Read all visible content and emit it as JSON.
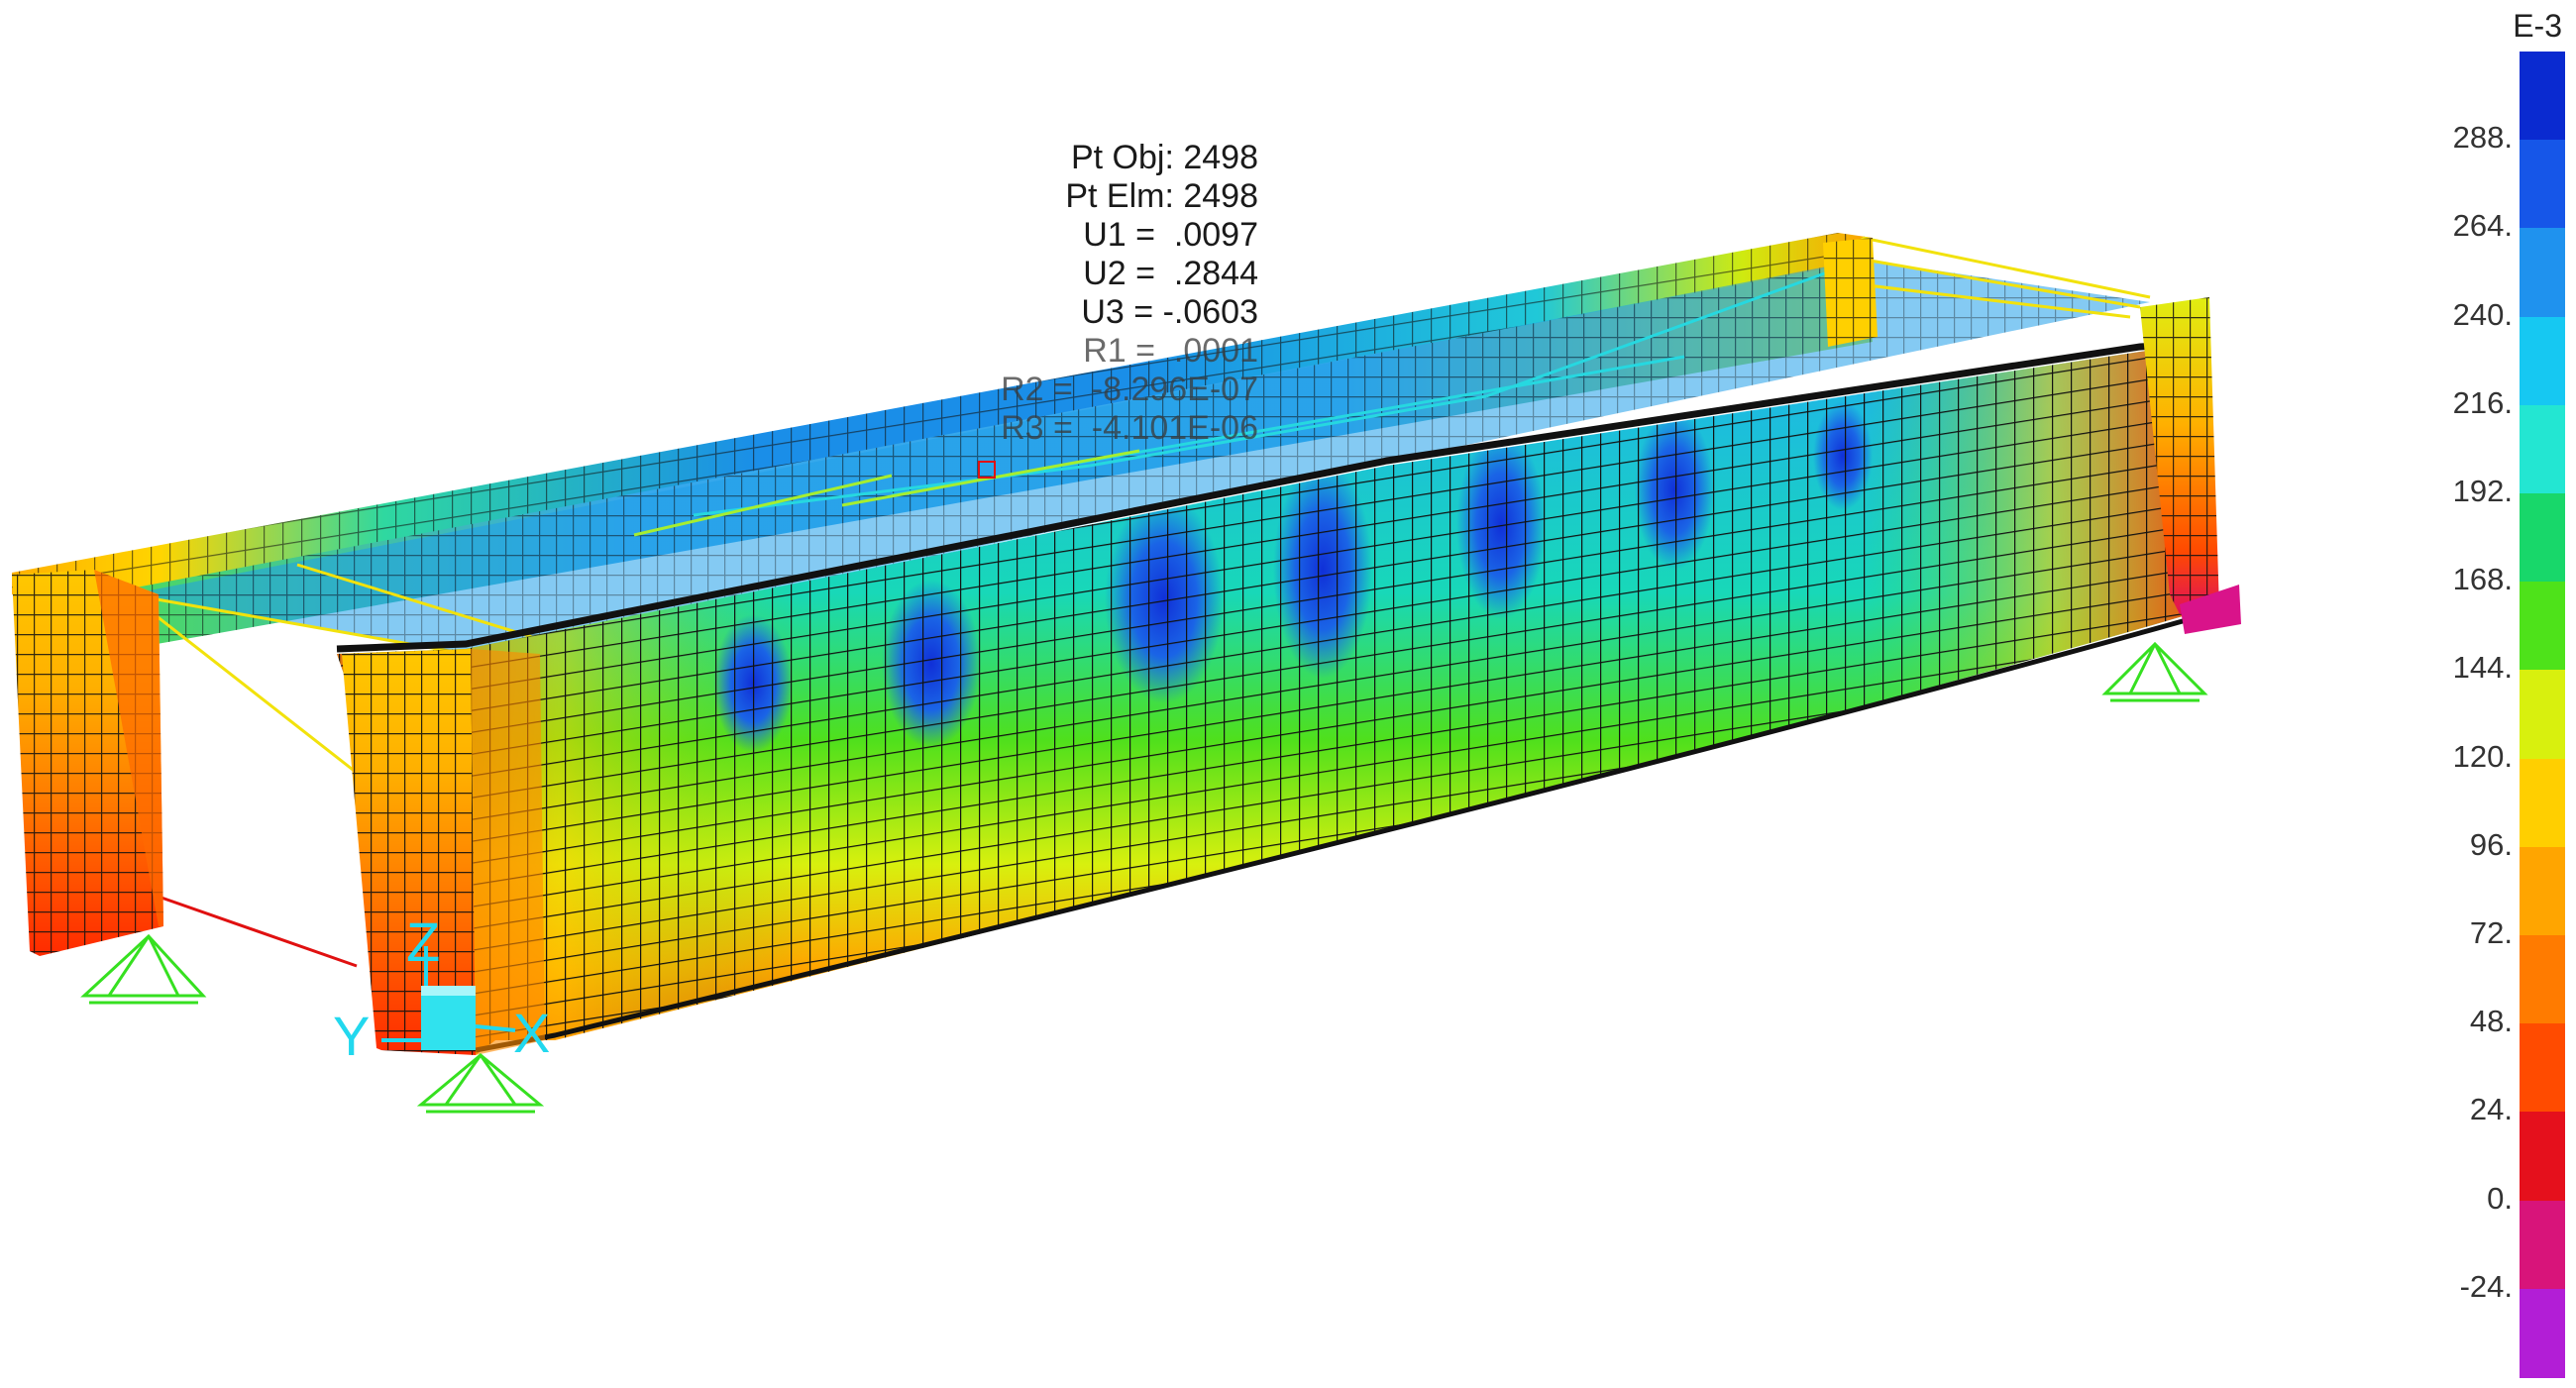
{
  "point_info": {
    "lines": [
      "Pt Obj: 2498",
      "Pt Elm: 2498",
      "U1 =  .0097",
      "U2 =  .2844",
      "U3 = -.0603",
      "R1 =  .0001",
      "R2 =  -8.296E-07",
      "R3 =  -4.101E-06"
    ]
  },
  "axes": {
    "x_label": "X",
    "y_label": "Y",
    "z_label": "Z"
  },
  "legend": {
    "exponent": "E-3",
    "tick_labels": [
      "288.",
      "264.",
      "240.",
      "216.",
      "192.",
      "168.",
      "144.",
      "120.",
      "96.",
      "72.",
      "48.",
      "24.",
      "0.",
      "-24."
    ],
    "colors": [
      "#0a2ad0",
      "#1656e8",
      "#1f92ee",
      "#16c8f2",
      "#23e6d2",
      "#18d76a",
      "#4ee21a",
      "#d8f00e",
      "#ffcf00",
      "#ffa500",
      "#ff7b00",
      "#ff4b00",
      "#e5101c",
      "#d8147a",
      "#b21ed6"
    ]
  }
}
